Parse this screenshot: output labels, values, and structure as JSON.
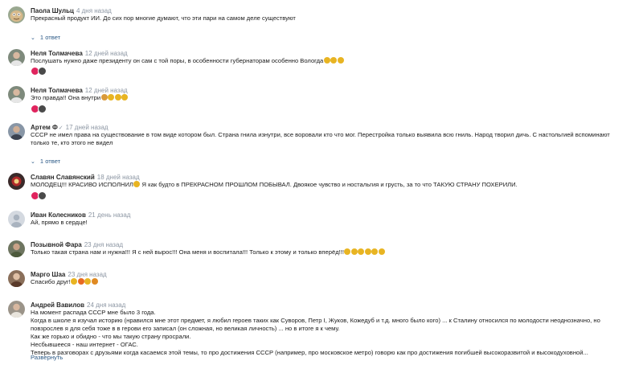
{
  "comments": [
    {
      "author": "Паола Шульц",
      "date": "4 дня назад",
      "lines": [
        "Прекрасный продукт ИИ. До сих пор многие думают, что эти пари на самом деле существуют"
      ],
      "avatar_icon": "cartoon-face-avatar",
      "avatar_color": "#9aa890",
      "replies_label": "1 ответ"
    },
    {
      "author": "Неля Толмачева",
      "date": "12 дней назад",
      "lines": [
        "Послушать нужно даже президенту он сам с той поры, в особенности губернаторам особенно Вологда"
      ],
      "avatar_icon": "person-photo-avatar",
      "avatar_color": "#7e8a7c",
      "emoji_after": [
        "thumbs-up",
        "thumbs-up",
        "thumbs-up"
      ],
      "reactions": [
        "heart",
        "heart-dark"
      ]
    },
    {
      "author": "Неля Толмачева",
      "date": "12 дней назад",
      "lines": [
        "Это правда!! Она внутри"
      ],
      "avatar_icon": "person-photo-avatar",
      "avatar_color": "#7e8a7c",
      "emoji_after": [
        "clap",
        "thumbs-up",
        "thumbs-up",
        "thumbs-up"
      ],
      "reactions": [
        "heart",
        "heart-dark"
      ]
    },
    {
      "author": "Артем Ф",
      "date": "17 дней назад",
      "lines": [
        "СССР не имел права на существование в том виде котором был. Страна гнила изнутри, все воровали кто что мог. Перестройка только выявила всю гниль. Народ творил дичь. С настольгией вспоминают",
        "только те, кто этого не видел"
      ],
      "avatar_icon": "person-photo-avatar",
      "avatar_color": "#8896a6",
      "verified": "✓",
      "replies_label": "1 ответ"
    },
    {
      "author": "Славян Славянский",
      "date": "18 дней назад",
      "lines": [
        "МОЛОДЕЦ!!! КРАСИВО ИСПОЛНИЛ"
      ],
      "line_rest": " Я как будто в ПРЕКРАСНОМ ПРОШЛОМ ПОБЫВАЛ. Двоякое чувство и ностальгия и грусть, за то что ТАКУЮ СТРАНУ ПОХЕРИЛИ.",
      "avatar_icon": "emblem-avatar",
      "avatar_color": "#3a2a2a",
      "emoji_inline": [
        "thumbs-up"
      ],
      "reactions": [
        "heart",
        "heart-dark"
      ]
    },
    {
      "author": "Иван Колесников",
      "date": "21 день назад",
      "lines": [
        "Ай, прямо в сердце!"
      ],
      "avatar_icon": "default-user-avatar",
      "avatar_color": "#d4d9e0"
    },
    {
      "author": "Позывной Фара",
      "date": "23 дня назад",
      "lines": [
        "Только такая страна нам и нужна!!! Я с ней вырос!!! Она меня и воспитала!!! Только к этому и только вперёд!!!"
      ],
      "avatar_icon": "person-photo-avatar",
      "avatar_color": "#6e7560",
      "emoji_after": [
        "thumbs-up",
        "heart",
        "hand",
        "hand",
        "hand",
        "hand"
      ]
    },
    {
      "author": "Марго Шаа",
      "date": "23 дня назад",
      "lines": [
        "Спасибо друг!"
      ],
      "avatar_icon": "person-photo-avatar",
      "avatar_color": "#8a6f5a",
      "emoji_after": [
        "pray",
        "fire",
        "flex",
        "heart"
      ]
    },
    {
      "author": "Андрей Вавилов",
      "date": "24 дня назад",
      "lines": [
        "На момент распада СССР мне было 3 года.",
        "Когда в школе я изучал историю (нравился мне этот предмет, я любил героев таких как Суворов, Петр I, Жуков, Кожедуб и т.д. много было кого) ... к Сталину относился по молодости неоднозначно, но",
        "повзрослев я для себя тоже в в герови его записал (он сложная, но великая личность) ... но в итоге я к чему.",
        "Как же горько и обидно - что мы такую страну просрали.",
        "Несбывшееся - наш интернет - ОГАС.",
        "Теперь в разговорах с друзьями когда касаемся этой темы, то про достижения СССР (например, про московское метро) говорю как про достижения погибшей высокоразвитой и высокодуховной..."
      ],
      "avatar_icon": "person-photo-avatar",
      "avatar_color": "#9b9489",
      "more_label": "Развернуть"
    }
  ],
  "colors": {
    "link": "#2a5885",
    "date": "#8c96a3",
    "thumbs": "#e8b422",
    "heart": "#e0245e",
    "heart_dark": "#4a4a4a"
  }
}
